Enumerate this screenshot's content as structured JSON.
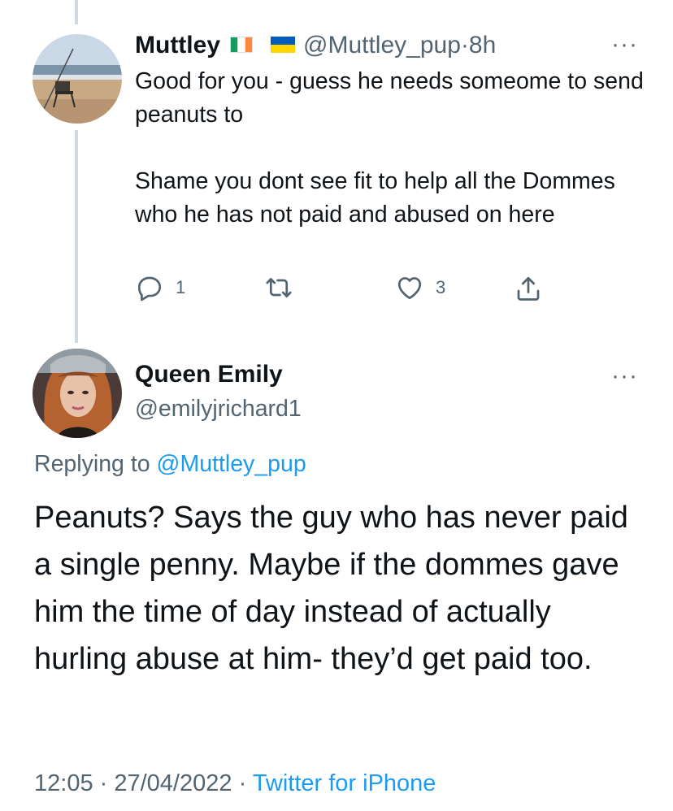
{
  "reply_tweet": {
    "display_name": "Muttley",
    "flags": [
      "ireland-flag-icon",
      "ukraine-flag-icon"
    ],
    "handle": "@Muttley_pup",
    "separator": " · ",
    "time_ago": "8h",
    "text": "Good for you - guess he needs someome to send peanuts to\n\nShame you dont see fit to help all the Dommes who he has not paid and abused on here",
    "actions": {
      "reply_count": "1",
      "retweet_count": "",
      "like_count": "3"
    },
    "more_label": "···"
  },
  "main_tweet": {
    "display_name": "Queen Emily",
    "handle": "@emilyjrichard1",
    "more_label": "···",
    "replying_prefix": "Replying to ",
    "replying_to": "@Muttley_pup",
    "text": "Peanuts? Says the guy who has never paid a single penny. Maybe if the dommes gave him the time of day instead of actually hurling abuse at him- they’d get paid too.",
    "time": "12:05",
    "date": "27/04/2022",
    "separator": " · ",
    "source": "Twitter for iPhone"
  },
  "colors": {
    "accent": "#1d9bf0",
    "muted": "#536471",
    "text": "#0f1419",
    "thread_line": "#cfd9de"
  }
}
